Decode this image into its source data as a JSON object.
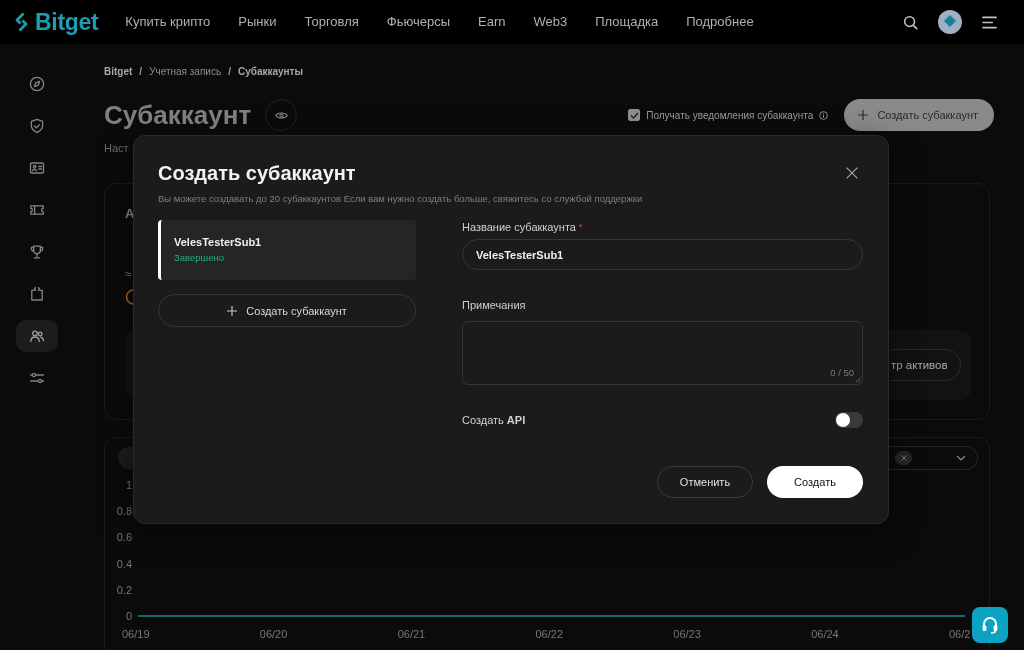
{
  "header": {
    "logo": "Bitget",
    "nav": [
      "Купить крипто",
      "Рынки",
      "Торговля",
      "Фьючерсы",
      "Earn",
      "Web3",
      "Площадка",
      "Подробнее"
    ]
  },
  "sidebar": {
    "items": [
      {
        "selected": false
      },
      {
        "selected": false
      },
      {
        "selected": false
      },
      {
        "selected": false
      },
      {
        "selected": false
      },
      {
        "selected": false
      },
      {
        "selected": true
      },
      {
        "selected": false
      }
    ]
  },
  "breadcrumb": [
    {
      "label": "Bitget"
    },
    {
      "separator": "/",
      "label": "Учетная запись"
    },
    {
      "separator": "/",
      "label": "Субаккаунты"
    }
  ],
  "page": {
    "title": "Субаккаунт",
    "subtitle": "Наст",
    "notify": {
      "label": "Получать уведомления субаккаунта",
      "checked": true
    },
    "create_button": "Создать субаккаунт"
  },
  "assets_card": {
    "heading": "А",
    "approx": "≈",
    "action": "тр активов"
  },
  "chart_panel": {
    "chart_data": {
      "type": "line",
      "categories": [
        "06/19",
        "06/20",
        "06/21",
        "06/22",
        "06/23",
        "06/24",
        "06/2"
      ],
      "series": [
        {
          "color": "#1a8c9a",
          "values": [
            0,
            0,
            0,
            0,
            0,
            0,
            0
          ]
        }
      ],
      "ylim": [
        0,
        1
      ],
      "yticks": [
        0,
        0.2,
        0.4,
        0.6,
        0.8,
        1
      ]
    }
  },
  "modal": {
    "title": "Создать субаккаунт",
    "description": "Вы можете создавать до 20 субаккаунтов Если вам нужно создать больше, свяжитесь со службой поддержки",
    "subaccounts": [
      {
        "name": "VelesTesterSub1",
        "status": "Завершено",
        "selected": true
      }
    ],
    "add_button": "Создать субаккаунт",
    "name_field": {
      "label": "Название субаккаунта",
      "required_mark": "*",
      "value": "VelesTesterSub1"
    },
    "notes_field": {
      "label": "Примечания",
      "counter": "0 / 50"
    },
    "api_toggle": {
      "label": "Создать **API**",
      "on": false
    },
    "buttons": {
      "cancel": "Отменить",
      "submit": "Создать"
    }
  }
}
